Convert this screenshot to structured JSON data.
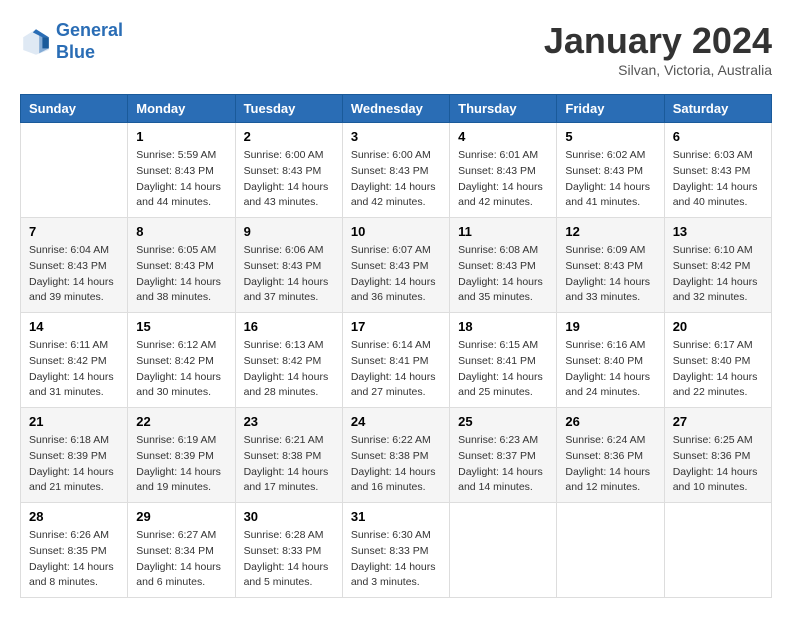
{
  "logo": {
    "line1": "General",
    "line2": "Blue"
  },
  "title": "January 2024",
  "subtitle": "Silvan, Victoria, Australia",
  "days": [
    "Sunday",
    "Monday",
    "Tuesday",
    "Wednesday",
    "Thursday",
    "Friday",
    "Saturday"
  ],
  "weeks": [
    [
      {
        "date": "",
        "sunrise": "",
        "sunset": "",
        "daylight": ""
      },
      {
        "date": "1",
        "sunrise": "Sunrise: 5:59 AM",
        "sunset": "Sunset: 8:43 PM",
        "daylight": "Daylight: 14 hours and 44 minutes."
      },
      {
        "date": "2",
        "sunrise": "Sunrise: 6:00 AM",
        "sunset": "Sunset: 8:43 PM",
        "daylight": "Daylight: 14 hours and 43 minutes."
      },
      {
        "date": "3",
        "sunrise": "Sunrise: 6:00 AM",
        "sunset": "Sunset: 8:43 PM",
        "daylight": "Daylight: 14 hours and 42 minutes."
      },
      {
        "date": "4",
        "sunrise": "Sunrise: 6:01 AM",
        "sunset": "Sunset: 8:43 PM",
        "daylight": "Daylight: 14 hours and 42 minutes."
      },
      {
        "date": "5",
        "sunrise": "Sunrise: 6:02 AM",
        "sunset": "Sunset: 8:43 PM",
        "daylight": "Daylight: 14 hours and 41 minutes."
      },
      {
        "date": "6",
        "sunrise": "Sunrise: 6:03 AM",
        "sunset": "Sunset: 8:43 PM",
        "daylight": "Daylight: 14 hours and 40 minutes."
      }
    ],
    [
      {
        "date": "7",
        "sunrise": "Sunrise: 6:04 AM",
        "sunset": "Sunset: 8:43 PM",
        "daylight": "Daylight: 14 hours and 39 minutes."
      },
      {
        "date": "8",
        "sunrise": "Sunrise: 6:05 AM",
        "sunset": "Sunset: 8:43 PM",
        "daylight": "Daylight: 14 hours and 38 minutes."
      },
      {
        "date": "9",
        "sunrise": "Sunrise: 6:06 AM",
        "sunset": "Sunset: 8:43 PM",
        "daylight": "Daylight: 14 hours and 37 minutes."
      },
      {
        "date": "10",
        "sunrise": "Sunrise: 6:07 AM",
        "sunset": "Sunset: 8:43 PM",
        "daylight": "Daylight: 14 hours and 36 minutes."
      },
      {
        "date": "11",
        "sunrise": "Sunrise: 6:08 AM",
        "sunset": "Sunset: 8:43 PM",
        "daylight": "Daylight: 14 hours and 35 minutes."
      },
      {
        "date": "12",
        "sunrise": "Sunrise: 6:09 AM",
        "sunset": "Sunset: 8:43 PM",
        "daylight": "Daylight: 14 hours and 33 minutes."
      },
      {
        "date": "13",
        "sunrise": "Sunrise: 6:10 AM",
        "sunset": "Sunset: 8:42 PM",
        "daylight": "Daylight: 14 hours and 32 minutes."
      }
    ],
    [
      {
        "date": "14",
        "sunrise": "Sunrise: 6:11 AM",
        "sunset": "Sunset: 8:42 PM",
        "daylight": "Daylight: 14 hours and 31 minutes."
      },
      {
        "date": "15",
        "sunrise": "Sunrise: 6:12 AM",
        "sunset": "Sunset: 8:42 PM",
        "daylight": "Daylight: 14 hours and 30 minutes."
      },
      {
        "date": "16",
        "sunrise": "Sunrise: 6:13 AM",
        "sunset": "Sunset: 8:42 PM",
        "daylight": "Daylight: 14 hours and 28 minutes."
      },
      {
        "date": "17",
        "sunrise": "Sunrise: 6:14 AM",
        "sunset": "Sunset: 8:41 PM",
        "daylight": "Daylight: 14 hours and 27 minutes."
      },
      {
        "date": "18",
        "sunrise": "Sunrise: 6:15 AM",
        "sunset": "Sunset: 8:41 PM",
        "daylight": "Daylight: 14 hours and 25 minutes."
      },
      {
        "date": "19",
        "sunrise": "Sunrise: 6:16 AM",
        "sunset": "Sunset: 8:40 PM",
        "daylight": "Daylight: 14 hours and 24 minutes."
      },
      {
        "date": "20",
        "sunrise": "Sunrise: 6:17 AM",
        "sunset": "Sunset: 8:40 PM",
        "daylight": "Daylight: 14 hours and 22 minutes."
      }
    ],
    [
      {
        "date": "21",
        "sunrise": "Sunrise: 6:18 AM",
        "sunset": "Sunset: 8:39 PM",
        "daylight": "Daylight: 14 hours and 21 minutes."
      },
      {
        "date": "22",
        "sunrise": "Sunrise: 6:19 AM",
        "sunset": "Sunset: 8:39 PM",
        "daylight": "Daylight: 14 hours and 19 minutes."
      },
      {
        "date": "23",
        "sunrise": "Sunrise: 6:21 AM",
        "sunset": "Sunset: 8:38 PM",
        "daylight": "Daylight: 14 hours and 17 minutes."
      },
      {
        "date": "24",
        "sunrise": "Sunrise: 6:22 AM",
        "sunset": "Sunset: 8:38 PM",
        "daylight": "Daylight: 14 hours and 16 minutes."
      },
      {
        "date": "25",
        "sunrise": "Sunrise: 6:23 AM",
        "sunset": "Sunset: 8:37 PM",
        "daylight": "Daylight: 14 hours and 14 minutes."
      },
      {
        "date": "26",
        "sunrise": "Sunrise: 6:24 AM",
        "sunset": "Sunset: 8:36 PM",
        "daylight": "Daylight: 14 hours and 12 minutes."
      },
      {
        "date": "27",
        "sunrise": "Sunrise: 6:25 AM",
        "sunset": "Sunset: 8:36 PM",
        "daylight": "Daylight: 14 hours and 10 minutes."
      }
    ],
    [
      {
        "date": "28",
        "sunrise": "Sunrise: 6:26 AM",
        "sunset": "Sunset: 8:35 PM",
        "daylight": "Daylight: 14 hours and 8 minutes."
      },
      {
        "date": "29",
        "sunrise": "Sunrise: 6:27 AM",
        "sunset": "Sunset: 8:34 PM",
        "daylight": "Daylight: 14 hours and 6 minutes."
      },
      {
        "date": "30",
        "sunrise": "Sunrise: 6:28 AM",
        "sunset": "Sunset: 8:33 PM",
        "daylight": "Daylight: 14 hours and 5 minutes."
      },
      {
        "date": "31",
        "sunrise": "Sunrise: 6:30 AM",
        "sunset": "Sunset: 8:33 PM",
        "daylight": "Daylight: 14 hours and 3 minutes."
      },
      {
        "date": "",
        "sunrise": "",
        "sunset": "",
        "daylight": ""
      },
      {
        "date": "",
        "sunrise": "",
        "sunset": "",
        "daylight": ""
      },
      {
        "date": "",
        "sunrise": "",
        "sunset": "",
        "daylight": ""
      }
    ]
  ]
}
